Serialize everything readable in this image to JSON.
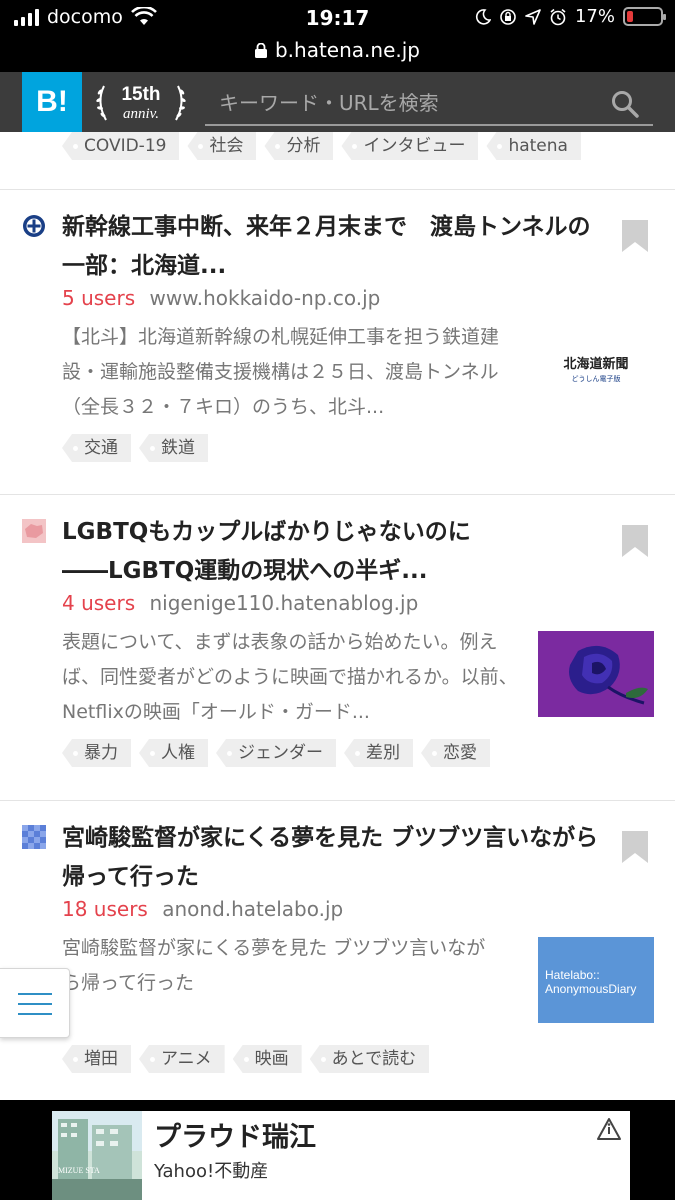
{
  "status_bar": {
    "carrier": "docomo",
    "time": "19:17",
    "battery": "17%"
  },
  "browser": {
    "url": "b.hatena.ne.jp"
  },
  "header": {
    "logo": "B!",
    "anniv_top": "15th",
    "anniv_bottom": "anniv.",
    "search_placeholder": "キーワード・URLを検索"
  },
  "first_tags": [
    "COVID-19",
    "社会",
    "分析",
    "インタビュー",
    "hatena"
  ],
  "entries": [
    {
      "title": "新幹線工事中断、来年２月末まで　渡島トンネルの一部：北海道...",
      "users": "5 users",
      "domain": "www.hokkaido-np.co.jp",
      "description": "【北斗】北海道新幹線の札幌延伸工事を担う鉄道建設・運輸施設整備支援機構は２５日、渡島トンネル（全長３２・７キロ）のうち、北斗...",
      "thumb_top": "北海道新聞",
      "thumb_bottom": "どうしん電子版",
      "tags": [
        "交通",
        "鉄道"
      ]
    },
    {
      "title": "LGBTQもカップルばかりじゃないのに――LGBTQ運動の現状への半ギ...",
      "users": "4 users",
      "domain": "nigenige110.hatenablog.jp",
      "description": "表題について、まずは表象の話から始めたい。例えば、同性愛者がどのように映画で描かれるか。以前、Netflixの映画「オールド・ガード...",
      "tags": [
        "暴力",
        "人権",
        "ジェンダー",
        "差別",
        "恋愛"
      ]
    },
    {
      "title": "宮崎駿監督が家にくる夢を見た ブツブツ言いながら帰って行った",
      "users": "18 users",
      "domain": "anond.hatelabo.jp",
      "description": "宮崎駿監督が家にくる夢を見た ブツブツ言いながら帰って行った",
      "thumb_line1": "Hatelabo::",
      "thumb_line2": "AnonymousDiary",
      "tags": [
        "増田",
        "アニメ",
        "映画",
        "あとで読む"
      ]
    }
  ],
  "ad": {
    "title": "プラウド瑞江",
    "sponsor": "Yahoo!不動産",
    "image_caption": "MIZUE STA"
  },
  "colors": {
    "hatena_blue": "#00a4de",
    "header_bg": "#3c3c3c",
    "users_red": "#e4424c",
    "menu_blue": "#2f8fc5"
  }
}
